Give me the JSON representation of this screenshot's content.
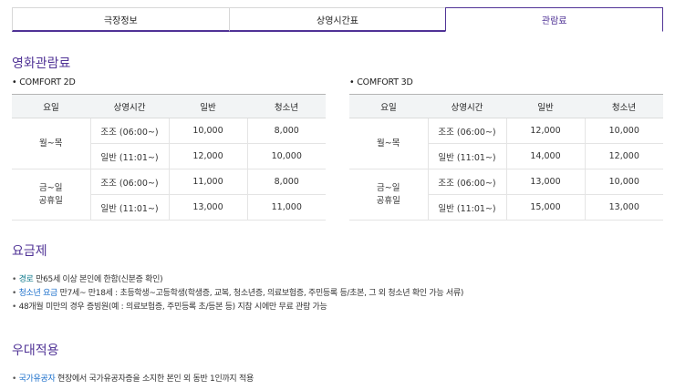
{
  "tabs": [
    "극장정보",
    "상영시간표",
    "관람료"
  ],
  "fee_title": "영화관람료",
  "comfort2d": {
    "title": "COMFORT 2D",
    "headers": [
      "요일",
      "상영시간",
      "일반",
      "청소년"
    ],
    "groups": [
      {
        "day_lines": [
          "월~목"
        ],
        "rows": [
          {
            "time": "조조 (06:00~)",
            "adult": "10,000",
            "teen": "8,000"
          },
          {
            "time": "일반 (11:01~)",
            "adult": "12,000",
            "teen": "10,000"
          }
        ]
      },
      {
        "day_lines": [
          "금~일",
          "공휴일"
        ],
        "rows": [
          {
            "time": "조조 (06:00~)",
            "adult": "11,000",
            "teen": "8,000"
          },
          {
            "time": "일반 (11:01~)",
            "adult": "13,000",
            "teen": "11,000"
          }
        ]
      }
    ]
  },
  "comfort3d": {
    "title": "COMFORT 3D",
    "headers": [
      "요일",
      "상영시간",
      "일반",
      "청소년"
    ],
    "groups": [
      {
        "day_lines": [
          "월~목"
        ],
        "rows": [
          {
            "time": "조조 (06:00~)",
            "adult": "12,000",
            "teen": "10,000"
          },
          {
            "time": "일반 (11:01~)",
            "adult": "14,000",
            "teen": "12,000"
          }
        ]
      },
      {
        "day_lines": [
          "금~일",
          "공휴일"
        ],
        "rows": [
          {
            "time": "조조 (06:00~)",
            "adult": "13,000",
            "teen": "10,000"
          },
          {
            "time": "일반 (11:01~)",
            "adult": "15,000",
            "teen": "13,000"
          }
        ]
      }
    ]
  },
  "rate_title": "요금제",
  "rate_items": [
    {
      "label": "경로",
      "text": "만65세 이상 본인에 한함(신분증 확인)"
    },
    {
      "label": "청소년 요금",
      "text": "만7세~ 만18세 : 초등학생~고등학생(학생증, 교복, 청소년증, 의료보험증, 주민등록 등/초본, 그 외 청소년 확인 가능 서류)"
    },
    {
      "label": "",
      "text": "48개월 미만의 경우 증빙원(예 : 의료보험증, 주민등록 초/등본 등) 지참 시에만 무료 관람 가능"
    }
  ],
  "benefit_title": "우대적용",
  "benefit_items": [
    {
      "label": "국가유공자",
      "text": "현장에서 국가유공자증을 소지한 본인 외 동반 1인까지 적용"
    }
  ],
  "colors": {
    "accent": "#503396",
    "teal": "#0f7a8c",
    "header_bg": "#f2f4f5"
  }
}
